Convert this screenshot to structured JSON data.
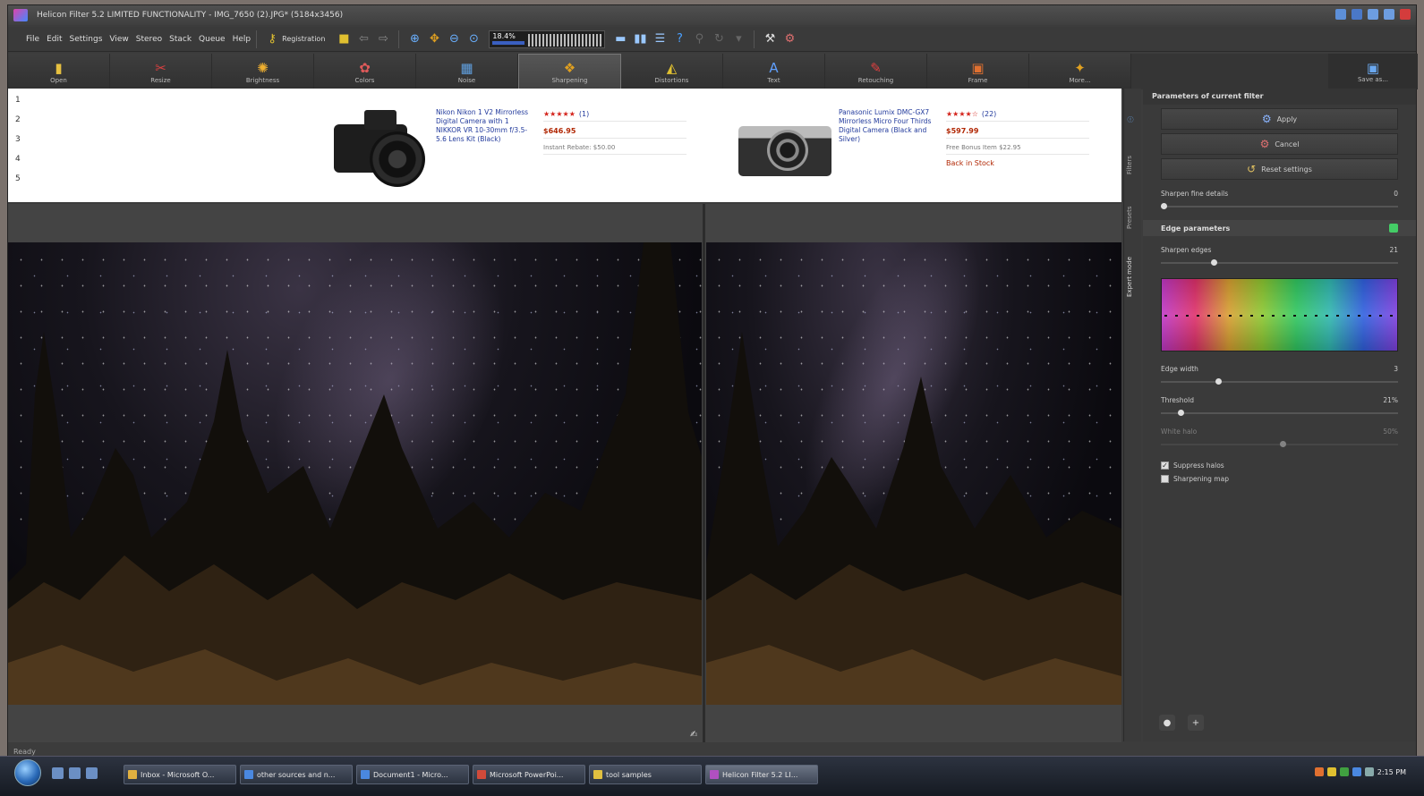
{
  "window": {
    "title": "Helicon Filter 5.2 LIMITED FUNCTIONALITY - IMG_7650 (2).JPG* (5184x3456)"
  },
  "menu": [
    "File",
    "Edit",
    "Settings",
    "View",
    "Stereo",
    "Stack",
    "Queue",
    "Help"
  ],
  "registration_label": "Registration",
  "zoom": "18.4%",
  "toolbar": [
    {
      "label": "Open",
      "icon": "folder-icon",
      "glyph": "▮",
      "color": "#e6c040"
    },
    {
      "label": "Resize",
      "icon": "resize-icon",
      "glyph": "✂",
      "color": "#d84040"
    },
    {
      "label": "Brightness",
      "icon": "sun-icon",
      "glyph": "✺",
      "color": "#f0b030"
    },
    {
      "label": "Colors",
      "icon": "palette-icon",
      "glyph": "✿",
      "color": "#e05a5a"
    },
    {
      "label": "Noise",
      "icon": "noise-icon",
      "glyph": "▦",
      "color": "#60a0e0"
    },
    {
      "label": "Sharpening",
      "icon": "sharpen-icon",
      "glyph": "❖",
      "color": "#e0a020",
      "selected": true
    },
    {
      "label": "Distortions",
      "icon": "distort-icon",
      "glyph": "◭",
      "color": "#e0c030"
    },
    {
      "label": "Text",
      "icon": "text-icon",
      "glyph": "A",
      "color": "#60a0ff"
    },
    {
      "label": "Retouching",
      "icon": "brush-icon",
      "glyph": "✎",
      "color": "#e04040"
    },
    {
      "label": "Frame",
      "icon": "frame-icon",
      "glyph": "▣",
      "color": "#e07030"
    },
    {
      "label": "More...",
      "icon": "wand-icon",
      "glyph": "✦",
      "color": "#e0a020"
    }
  ],
  "save_as": "Save as...",
  "ad": {
    "row_numbers": [
      "1",
      "2",
      "3",
      "4",
      "5"
    ],
    "products": [
      {
        "desc": "Nikon Nikon 1 V2 Mirrorless Digital Camera with 1 NIKKOR VR 10-30mm f/3.5-5.6 Lens Kit (Black)",
        "rating": "★★★★★",
        "reviews": "(1)",
        "price": "$646.95",
        "extra": "Instant Rebate: $50.00",
        "stock": ""
      },
      {
        "desc": "Panasonic Lumix DMC-GX7 Mirrorless Micro Four Thirds Digital Camera (Black and Silver)",
        "rating": "★★★★☆",
        "reviews": "(22)",
        "price": "$597.99",
        "extra": "Free Bonus Item $22.95",
        "stock": "Back in Stock"
      }
    ]
  },
  "right_panel": {
    "header": "Parameters of current filter",
    "apply": "Apply",
    "cancel": "Cancel",
    "reset": "Reset settings",
    "fine_details": {
      "label": "Sharpen fine details",
      "value": "0"
    },
    "edge_header": "Edge parameters",
    "sharpen_edges": {
      "label": "Sharpen edges",
      "value": "21"
    },
    "edge_width": {
      "label": "Edge width",
      "value": "3"
    },
    "threshold": {
      "label": "Threshold",
      "value": "21%"
    },
    "white_halo": {
      "label": "White halo",
      "value": "50%"
    },
    "suppress_halos": "Suppress halos",
    "sharpening_map": "Sharpening map",
    "tabs": [
      "Expert mode",
      "Presets",
      "Filters"
    ]
  },
  "status": "Ready",
  "taskbar": {
    "tasks": [
      "Inbox - Microsoft O...",
      "other sources and n...",
      "Document1 - Micro...",
      "Microsoft PowerPoi...",
      "tool samples",
      "Helicon Filter 5.2 LI..."
    ],
    "clock": "2:15 PM"
  }
}
